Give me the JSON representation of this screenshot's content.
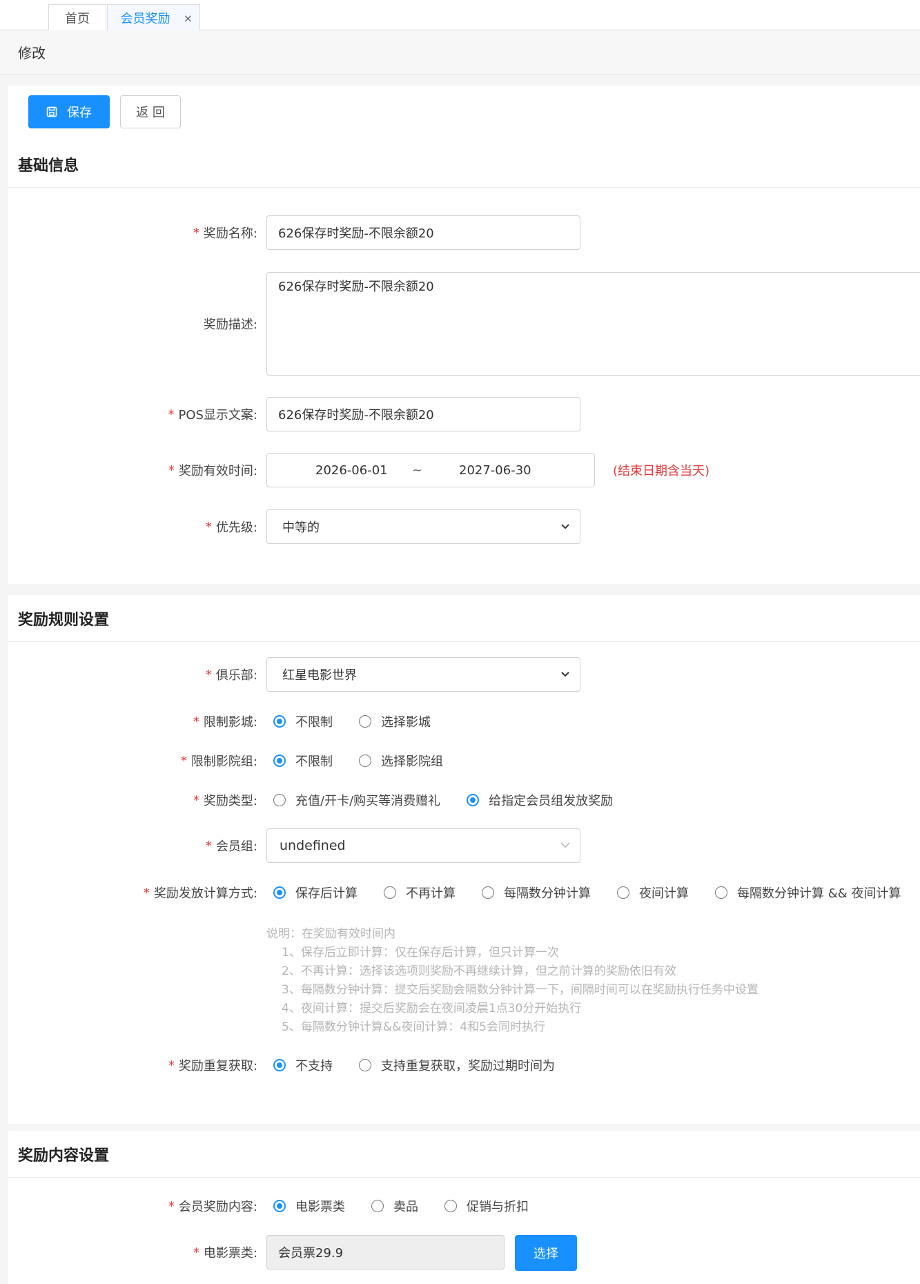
{
  "tabs": [
    {
      "label": "首页"
    },
    {
      "label": "会员奖励",
      "close": "×"
    }
  ],
  "page_title": "修改",
  "toolbar": {
    "save_label": "保存",
    "back_label": "返 回"
  },
  "sections": {
    "basic": "基础信息",
    "rules": "奖励规则设置",
    "content": "奖励内容设置"
  },
  "basic": {
    "name": {
      "label": "奖励名称:",
      "value": "626保存时奖励-不限余额20"
    },
    "desc": {
      "label": "奖励描述:",
      "value": "626保存时奖励-不限余额20"
    },
    "pos": {
      "label": "POS显示文案:",
      "value": "626保存时奖励-不限余额20"
    },
    "valid": {
      "label": "奖励有效时间:",
      "start": "2026-06-01",
      "sep": "~",
      "end": "2027-06-30",
      "hint": "(结束日期含当天)"
    },
    "priority": {
      "label": "优先级:",
      "value": "中等的"
    }
  },
  "rules": {
    "club": {
      "label": "俱乐部:",
      "value": "红星电影世界"
    },
    "cinema": {
      "label": "限制影城:",
      "options": [
        "不限制",
        "选择影城"
      ],
      "selected": 0
    },
    "cinema_group": {
      "label": "限制影院组:",
      "options": [
        "不限制",
        "选择影院组"
      ],
      "selected": 0
    },
    "type": {
      "label": "奖励类型:",
      "options": [
        "充值/开卡/购买等消费赠礼",
        "给指定会员组发放奖励"
      ],
      "selected": 1
    },
    "member_group": {
      "label": "会员组:",
      "value": "undefined"
    },
    "calc": {
      "label": "奖励发放计算方式:",
      "options": [
        "保存后计算",
        "不再计算",
        "每隔数分钟计算",
        "夜间计算",
        "每隔数分钟计算 && 夜间计算"
      ],
      "selected": 0
    },
    "note": {
      "title": "说明：在奖励有效时间内",
      "items": [
        "1、保存后立即计算：仅在保存后计算，但只计算一次",
        "2、不再计算：选择该选项则奖励不再继续计算，但之前计算的奖励依旧有效",
        "3、每隔数分钟计算：提交后奖励会隔数分钟计算一下，间隔时间可以在奖励执行任务中设置",
        "4、夜间计算：提交后奖励会在夜间凌晨1点30分开始执行",
        "5、每隔数分钟计算&&夜间计算：4和5会同时执行"
      ]
    },
    "repeat": {
      "label": "奖励重复获取:",
      "options": [
        "不支持",
        "支持重复获取，奖励过期时间为"
      ],
      "selected": 0
    }
  },
  "content": {
    "reward": {
      "label": "会员奖励内容:",
      "options": [
        "电影票类",
        "卖品",
        "促销与折扣"
      ],
      "selected": 0
    },
    "ticket": {
      "label": "电影票类:",
      "value": "会员票29.9",
      "button": "选择"
    }
  },
  "colors": {
    "primary": "#1890ff",
    "required": "#e4393c"
  }
}
